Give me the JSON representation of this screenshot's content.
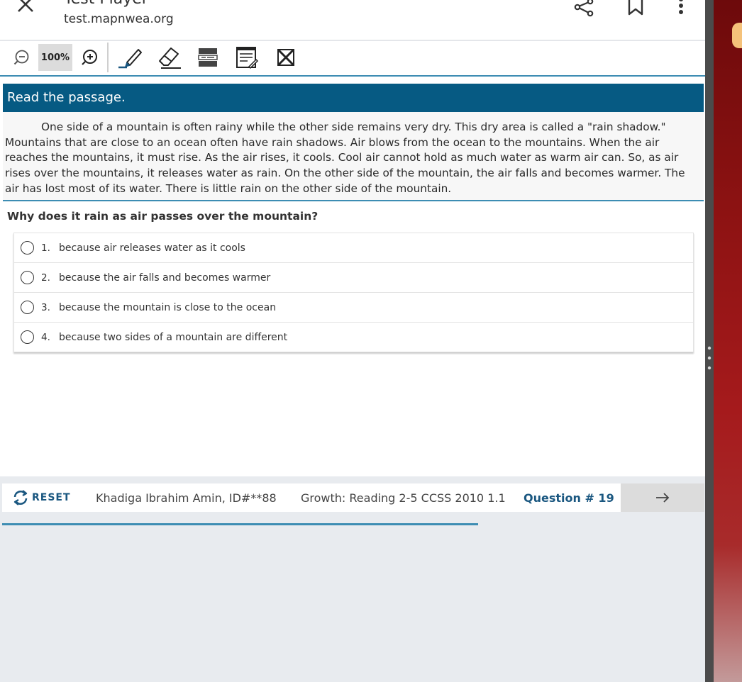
{
  "browser": {
    "title_fragment": "Test Player",
    "url": "test.mapnwea.org"
  },
  "toolbar": {
    "zoom_level": "100%"
  },
  "passage": {
    "heading": "Read the passage.",
    "text": "One side of a mountain is often rainy while the other side remains very dry. This dry area is called a \"rain shadow.\" Mountains that are close to an ocean often have rain shadows. Air blows from the ocean to the mountains. When the air reaches the mountains, it must rise. As the air rises, it cools. Cool air cannot hold as much water as warm air can. So, as air rises over the mountains, it releases water as rain. On the other side of the mountain, the air falls and becomes warmer. The air has lost most of its water. There is little rain on the other side of the mountain."
  },
  "question": {
    "prompt": "Why does it rain as air passes over the mountain?",
    "choices": [
      {
        "number": "1.",
        "text": "because air releases water as it cools"
      },
      {
        "number": "2.",
        "text": "because the air falls and becomes warmer"
      },
      {
        "number": "3.",
        "text": "because the mountain is close to the ocean"
      },
      {
        "number": "4.",
        "text": "because two sides of a mountain are different"
      }
    ]
  },
  "footer": {
    "reset_label": "RESET",
    "student": "Khadiga Ibrahim Amin, ID#**88",
    "test_name": "Growth: Reading 2-5 CCSS 2010 1.1",
    "question_number": "Question # 19"
  },
  "icons": {
    "close": "close-icon",
    "share": "share-icon",
    "bookmark": "bookmark-icon",
    "menu": "kebab-menu-icon",
    "zoom_out": "zoom-out-icon",
    "zoom_in": "zoom-in-icon",
    "highlighter": "highlighter-icon",
    "eraser": "eraser-icon",
    "line_reader": "line-reader-icon",
    "notepad": "notepad-icon",
    "answer_eliminator": "answer-eliminator-icon",
    "reset": "reset-icon",
    "next": "arrow-right-icon"
  },
  "colors": {
    "passage_header": "#065a83",
    "accent_blue": "#3d8db3",
    "link_blue": "#1a5780"
  }
}
